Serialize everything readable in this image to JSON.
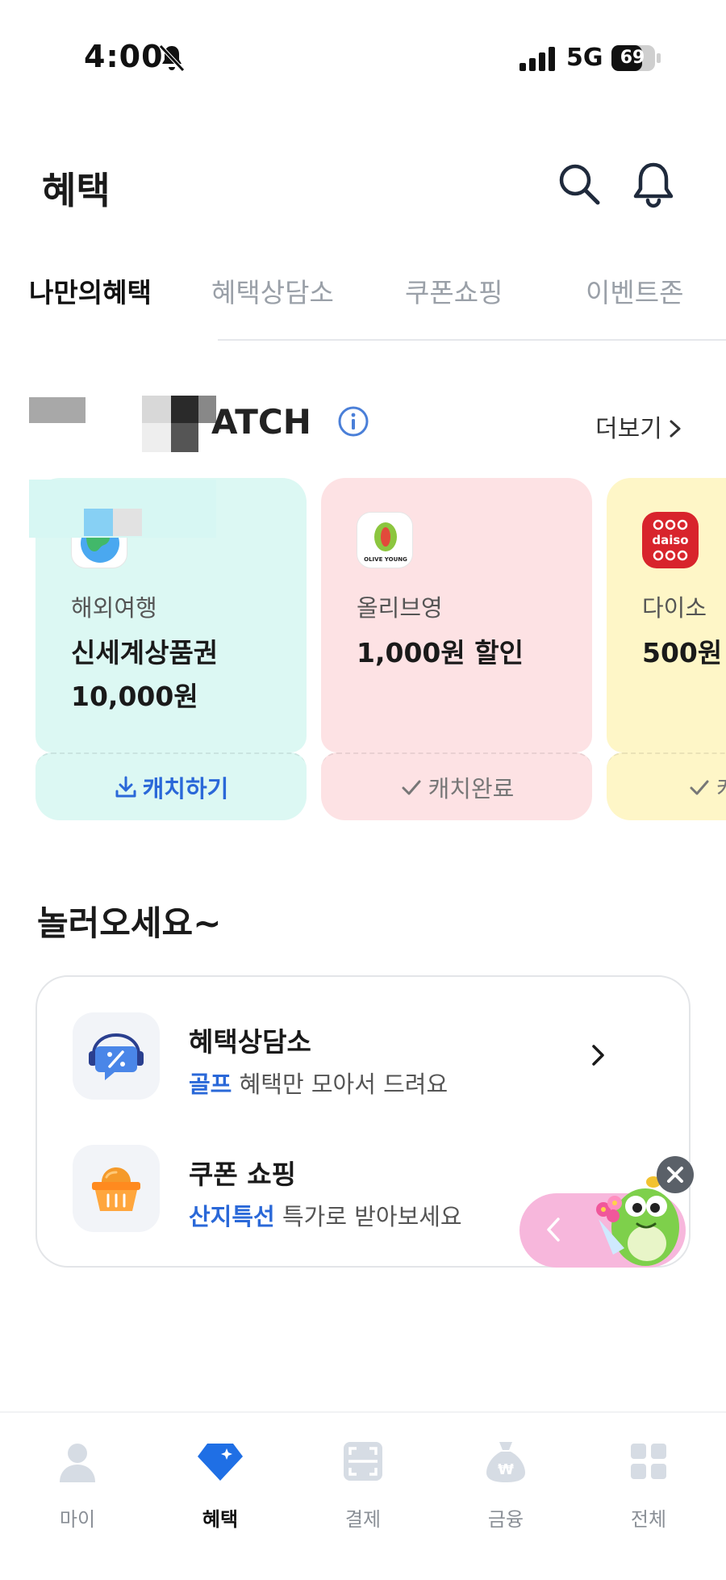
{
  "status_bar": {
    "time": "4:00",
    "network": "5G",
    "battery": "69"
  },
  "header": {
    "title": "혜택"
  },
  "tabs": [
    {
      "label": "나만의혜택",
      "active": true
    },
    {
      "label": "혜택상담소",
      "active": false
    },
    {
      "label": "쿠폰쇼핑",
      "active": false
    },
    {
      "label": "이벤트존",
      "active": false
    }
  ],
  "catch_section": {
    "title": "ATCH",
    "more_label": "더보기",
    "cards": [
      {
        "category": "해외여행",
        "name": "신세계상품권 10,000원",
        "button": "캐치하기",
        "state": "catchable",
        "bg": "#dcf8f3"
      },
      {
        "category": "올리브영",
        "name": "1,000원 할인",
        "logo_text": "OLIVE YOUNG",
        "button": "캐치완료",
        "state": "done",
        "bg": "#fde2e4"
      },
      {
        "category": "다이소",
        "name": "500원",
        "logo_text": "daiso",
        "button": "캐치완료",
        "state": "done",
        "bg": "#fef6c7"
      }
    ]
  },
  "section2": {
    "title": "놀러오세요~",
    "items": [
      {
        "title": "혜택상담소",
        "highlight": "골프",
        "subtitle": " 혜택만 모아서 드려요"
      },
      {
        "title": "쿠폰 쇼핑",
        "highlight": "산지특선",
        "subtitle": " 특가로 받아보세요"
      }
    ]
  },
  "bottom_nav": [
    {
      "label": "마이",
      "icon": "person-icon",
      "active": false
    },
    {
      "label": "혜택",
      "icon": "diamond-icon",
      "active": true
    },
    {
      "label": "결제",
      "icon": "scan-icon",
      "active": false
    },
    {
      "label": "금융",
      "icon": "money-bag-icon",
      "active": false
    },
    {
      "label": "전체",
      "icon": "grid-icon",
      "active": false
    }
  ],
  "colors": {
    "accent": "#2a68d8",
    "active_nav": "#1f6fe5",
    "inactive_icon": "#d6dce4"
  }
}
